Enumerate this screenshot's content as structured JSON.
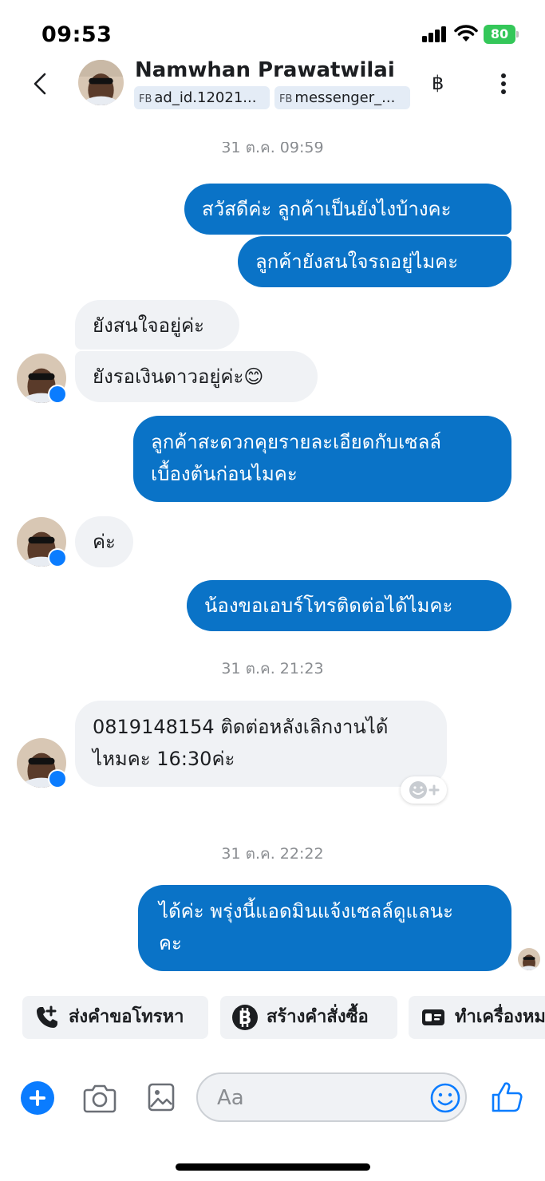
{
  "status_bar": {
    "time": "09:53",
    "battery": "80"
  },
  "header": {
    "contact_name": "Namwhan Prawatwilai",
    "tags": [
      {
        "prefix": "FB",
        "label": "ad_id.12021..."
      },
      {
        "prefix": "FB",
        "label": "messenger_..."
      }
    ],
    "currency_icon": "baht-icon",
    "currency_symbol": "฿"
  },
  "messages": [
    {
      "type": "timestamp",
      "text": "31 ต.ค. 09:59"
    },
    {
      "type": "outgoing",
      "text": "สวัสดีค่ะ ลูกค้าเป็นยังไงบ้างคะ"
    },
    {
      "type": "outgoing",
      "text": "ลูกค้ายังสนใจรถอยู่ไมคะ"
    },
    {
      "type": "incoming",
      "text": "ยังสนใจอยู่ค่ะ"
    },
    {
      "type": "incoming",
      "text": "ยังรอเงินดาวอยู่ค่ะ",
      "emoji": "😊"
    },
    {
      "type": "outgoing",
      "lines": [
        "ลูกค้าสะดวกคุยรายละเอียดกับเซลล์",
        "เบื้องต้นก่อนไมคะ"
      ]
    },
    {
      "type": "incoming",
      "text": "ค่ะ"
    },
    {
      "type": "outgoing",
      "text": "น้องขอเอบร์โทรติดต่อได้ไมคะ"
    },
    {
      "type": "timestamp",
      "text": "31 ต.ค. 21:23"
    },
    {
      "type": "incoming",
      "lines": [
        "0819148154 ติดต่อหลังเลิกงานได้",
        "ไหมคะ 16:30ค่ะ"
      ]
    },
    {
      "type": "timestamp",
      "text": "31 ต.ค. 22:22"
    },
    {
      "type": "outgoing",
      "lines": [
        "ได้ค่ะ พรุ่งนี้แอดมินแจ้งเซลล์ดูแลนะ",
        "คะ"
      ]
    }
  ],
  "quick_actions": [
    {
      "icon": "phone-plus-icon",
      "label": "ส่งคำขอโทรหา"
    },
    {
      "icon": "bitcoin-icon",
      "label": "สร้างคำสั่งซื้อ"
    },
    {
      "icon": "id-card-icon",
      "label": "ทำเครื่องหม"
    }
  ],
  "composer": {
    "placeholder": "Aa"
  },
  "colors": {
    "outgoing_bubble": "#0a73c7",
    "incoming_bubble": "#f0f2f5",
    "accent": "#0a7cff",
    "battery": "#34c759"
  }
}
